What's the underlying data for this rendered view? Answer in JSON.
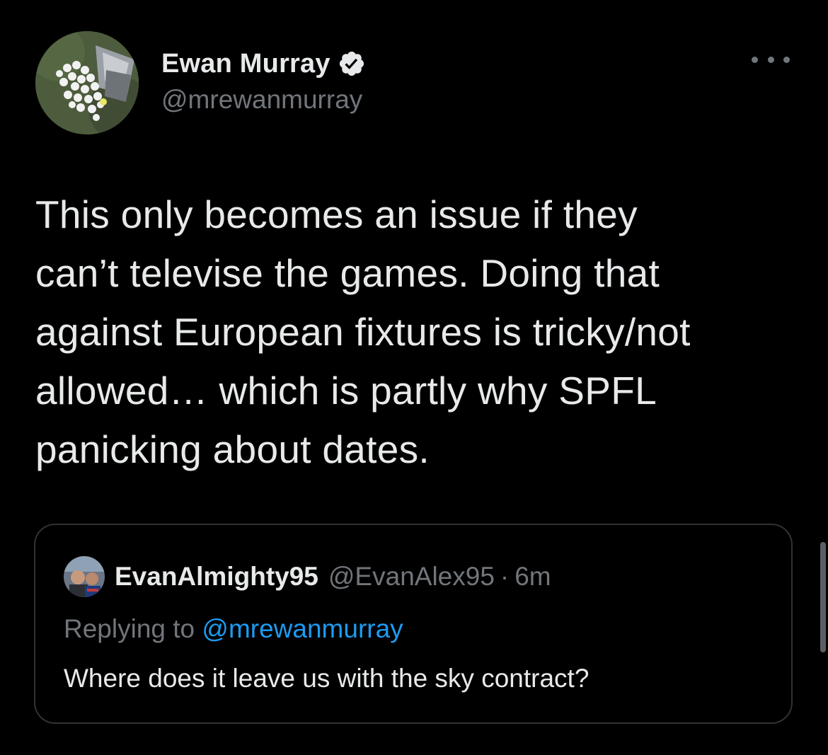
{
  "tweet": {
    "author": {
      "display_name": "Ewan Murray",
      "handle": "@mrewanmurray",
      "verified": true,
      "avatar_icon": "golf-balls-avatar"
    },
    "more_icon": "more-options-icon",
    "text": "This only becomes an issue if they\ncan’t televise the games. Doing that\nagainst European fixtures is tricky/not\nallowed… which is partly why SPFL\npanicking about dates.",
    "quoted": {
      "display_name": "EvanAlmighty95",
      "handle": "@EvanAlex95",
      "separator": "·",
      "time": "6m",
      "replying_prefix": "Replying to",
      "replying_handle": "@mrewanmurray",
      "text": "Where does it leave us with the sky contract?"
    }
  },
  "colors": {
    "background": "#000000",
    "primary_text": "#e7e9ea",
    "secondary_text": "#71767b",
    "link": "#1d9bf0",
    "border": "#2f3336"
  }
}
